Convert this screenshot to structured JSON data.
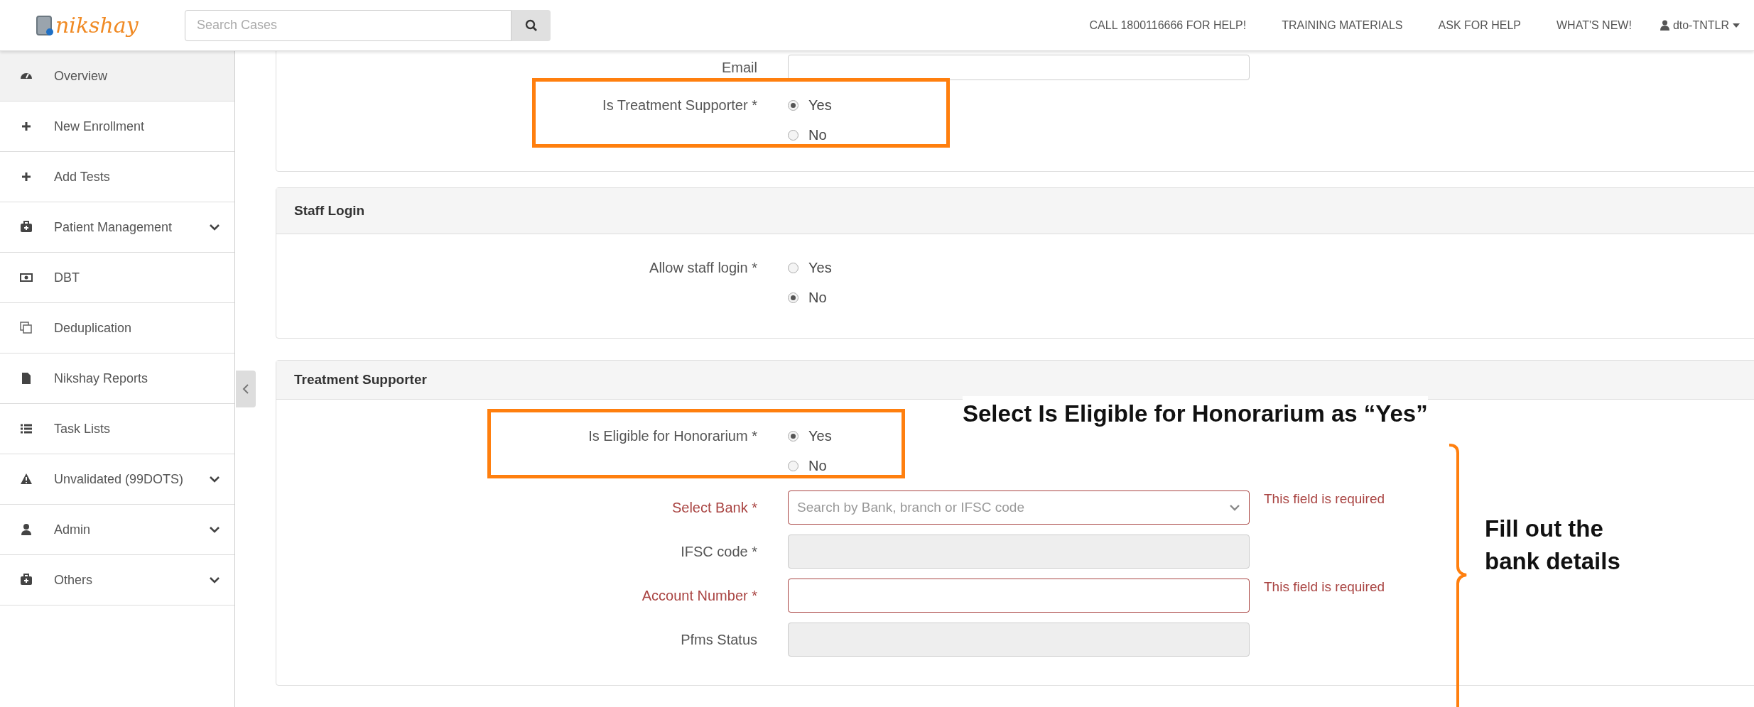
{
  "header": {
    "logo_text": "nikshay",
    "search": {
      "placeholder": "Search Cases"
    },
    "nav_links": [
      "CALL 1800116666 FOR HELP!",
      "TRAINING MATERIALS",
      "ASK FOR HELP",
      "WHAT'S NEW!"
    ],
    "user": "dto-TNTLR"
  },
  "sidebar": {
    "items": [
      {
        "label": "Overview",
        "selected": true,
        "expandable": false
      },
      {
        "label": "New Enrollment",
        "selected": false,
        "expandable": false
      },
      {
        "label": "Add Tests",
        "selected": false,
        "expandable": false
      },
      {
        "label": "Patient Management",
        "selected": false,
        "expandable": true
      },
      {
        "label": "DBT",
        "selected": false,
        "expandable": false
      },
      {
        "label": "Deduplication",
        "selected": false,
        "expandable": false
      },
      {
        "label": "Nikshay Reports",
        "selected": false,
        "expandable": false
      },
      {
        "label": "Task Lists",
        "selected": false,
        "expandable": false
      },
      {
        "label": "Unvalidated (99DOTS)",
        "selected": false,
        "expandable": true
      },
      {
        "label": "Admin",
        "selected": false,
        "expandable": true
      },
      {
        "label": "Others",
        "selected": false,
        "expandable": true
      }
    ]
  },
  "sections": [
    {
      "fields": [
        {
          "kind": "text",
          "label": "Email",
          "disabled": false,
          "error": false
        },
        {
          "kind": "radio",
          "label": "Is Treatment Supporter *",
          "highlighted": true,
          "options": [
            {
              "label": "Yes",
              "selected": true
            },
            {
              "label": "No",
              "selected": false
            }
          ]
        }
      ]
    },
    {
      "title": "Staff Login",
      "fields": [
        {
          "kind": "radio",
          "label": "Allow staff login *",
          "highlighted": false,
          "options": [
            {
              "label": "Yes",
              "selected": false
            },
            {
              "label": "No",
              "selected": true
            }
          ]
        }
      ]
    },
    {
      "title": "Treatment Supporter",
      "fields": [
        {
          "kind": "radio",
          "label": "Is Eligible for Honorarium *",
          "highlighted": true,
          "options": [
            {
              "label": "Yes",
              "selected": true
            },
            {
              "label": "No",
              "selected": false
            }
          ]
        },
        {
          "kind": "select",
          "label": "Select Bank *",
          "placeholder": "Search by Bank, branch or IFSC code",
          "error": true,
          "error_message": "This field is required"
        },
        {
          "kind": "text",
          "label": "IFSC code *",
          "disabled": true,
          "error": false
        },
        {
          "kind": "text",
          "label": "Account Number *",
          "disabled": false,
          "error": true,
          "error_message": "This field is required"
        },
        {
          "kind": "text",
          "label": "Pfms Status",
          "disabled": true,
          "error": false
        }
      ]
    }
  ],
  "annotations": [
    {
      "kind": "callout",
      "text": "Select Is Eligible for Honorarium as “Yes”"
    },
    {
      "kind": "bracket",
      "text": "Fill out the bank details"
    }
  ]
}
